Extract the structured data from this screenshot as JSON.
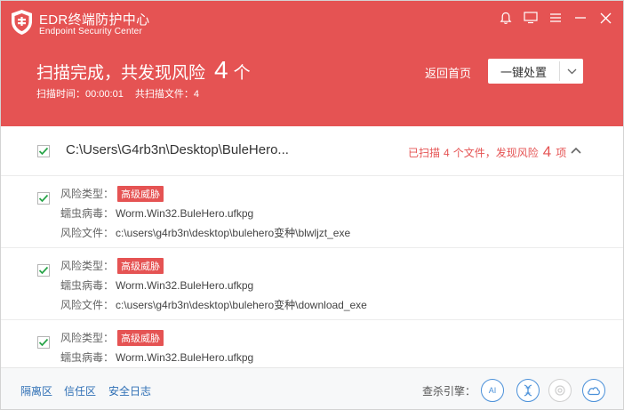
{
  "app": {
    "title": "EDR终端防护中心",
    "subtitle": "Endpoint Security Center"
  },
  "header": {
    "scan_title_prefix": "扫描完成，共发现风险",
    "risk_count": "4",
    "risk_unit": "个",
    "scan_time_label": "扫描时间：00:00:01",
    "scanned_files_label": "共扫描文件：4",
    "back_home": "返回首页",
    "action_button": "一键处置"
  },
  "group": {
    "path": "C:\\Users\\G4rb3n\\Desktop\\BuleHero...",
    "status_prefix": "已扫描",
    "scanned_count": "4",
    "status_mid": "个文件，发现风险",
    "risk_count": "4",
    "status_suffix": "项"
  },
  "labels": {
    "risk_type": "风险类型：",
    "worm": "蠕虫病毒：",
    "risk_file": "风险文件："
  },
  "items": [
    {
      "risk_level": "高级威胁",
      "virus": "Worm.Win32.BuleHero.ufkpg",
      "file": "c:\\users\\g4rb3n\\desktop\\bulehero变种\\blwljzt_exe"
    },
    {
      "risk_level": "高级威胁",
      "virus": "Worm.Win32.BuleHero.ufkpg",
      "file": "c:\\users\\g4rb3n\\desktop\\bulehero变种\\download_exe"
    },
    {
      "risk_level": "高级威胁",
      "virus": "Worm.Win32.BuleHero.ufkpg",
      "file": ""
    }
  ],
  "footer": {
    "quarantine": "隔离区",
    "trust": "信任区",
    "security_log": "安全日志",
    "engine_label": "查杀引擎：",
    "engines": [
      "AI"
    ]
  },
  "colors": {
    "accent": "#e55353",
    "link": "#2f6fb5",
    "check": "#2aa54a"
  }
}
